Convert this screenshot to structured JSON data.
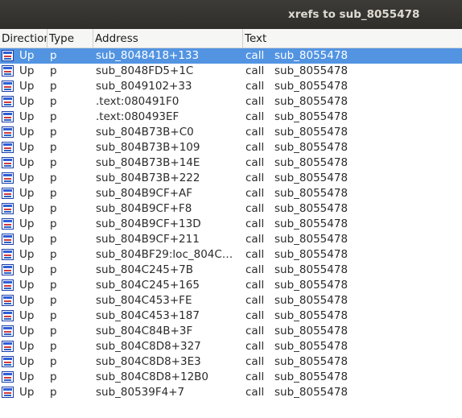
{
  "window": {
    "title": "xrefs to sub_8055478"
  },
  "columns": {
    "direction": "Direction",
    "type": "Type",
    "address": "Address",
    "text": "Text"
  },
  "icons": {
    "direction": "xref-up-icon"
  },
  "colors": {
    "selection": "#5294e2",
    "titlebar": "#3c3b37"
  },
  "rows": [
    {
      "direction": "Up",
      "type": "p",
      "address": "sub_8048418+133",
      "kw": "call",
      "target": "sub_8055478",
      "selected": true
    },
    {
      "direction": "Up",
      "type": "p",
      "address": "sub_8048FD5+1C",
      "kw": "call",
      "target": "sub_8055478"
    },
    {
      "direction": "Up",
      "type": "p",
      "address": "sub_8049102+33",
      "kw": "call",
      "target": "sub_8055478"
    },
    {
      "direction": "Up",
      "type": "p",
      "address": ".text:080491F0",
      "kw": "call",
      "target": "sub_8055478"
    },
    {
      "direction": "Up",
      "type": "p",
      "address": ".text:080493EF",
      "kw": "call",
      "target": "sub_8055478"
    },
    {
      "direction": "Up",
      "type": "p",
      "address": "sub_804B73B+C0",
      "kw": "call",
      "target": "sub_8055478"
    },
    {
      "direction": "Up",
      "type": "p",
      "address": "sub_804B73B+109",
      "kw": "call",
      "target": "sub_8055478"
    },
    {
      "direction": "Up",
      "type": "p",
      "address": "sub_804B73B+14E",
      "kw": "call",
      "target": "sub_8055478"
    },
    {
      "direction": "Up",
      "type": "p",
      "address": "sub_804B73B+222",
      "kw": "call",
      "target": "sub_8055478"
    },
    {
      "direction": "Up",
      "type": "p",
      "address": "sub_804B9CF+AF",
      "kw": "call",
      "target": "sub_8055478"
    },
    {
      "direction": "Up",
      "type": "p",
      "address": "sub_804B9CF+F8",
      "kw": "call",
      "target": "sub_8055478"
    },
    {
      "direction": "Up",
      "type": "p",
      "address": "sub_804B9CF+13D",
      "kw": "call",
      "target": "sub_8055478"
    },
    {
      "direction": "Up",
      "type": "p",
      "address": "sub_804B9CF+211",
      "kw": "call",
      "target": "sub_8055478"
    },
    {
      "direction": "Up",
      "type": "p",
      "address": "sub_804BF29:loc_804C…",
      "kw": "call",
      "target": "sub_8055478"
    },
    {
      "direction": "Up",
      "type": "p",
      "address": "sub_804C245+7B",
      "kw": "call",
      "target": "sub_8055478"
    },
    {
      "direction": "Up",
      "type": "p",
      "address": "sub_804C245+165",
      "kw": "call",
      "target": "sub_8055478"
    },
    {
      "direction": "Up",
      "type": "p",
      "address": "sub_804C453+FE",
      "kw": "call",
      "target": "sub_8055478"
    },
    {
      "direction": "Up",
      "type": "p",
      "address": "sub_804C453+187",
      "kw": "call",
      "target": "sub_8055478"
    },
    {
      "direction": "Up",
      "type": "p",
      "address": "sub_804C84B+3F",
      "kw": "call",
      "target": "sub_8055478"
    },
    {
      "direction": "Up",
      "type": "p",
      "address": "sub_804C8D8+327",
      "kw": "call",
      "target": "sub_8055478"
    },
    {
      "direction": "Up",
      "type": "p",
      "address": "sub_804C8D8+3E3",
      "kw": "call",
      "target": "sub_8055478"
    },
    {
      "direction": "Up",
      "type": "p",
      "address": "sub_804C8D8+12B0",
      "kw": "call",
      "target": "sub_8055478"
    },
    {
      "direction": "Up",
      "type": "p",
      "address": "sub_80539F4+7",
      "kw": "call",
      "target": "sub_8055478"
    }
  ]
}
